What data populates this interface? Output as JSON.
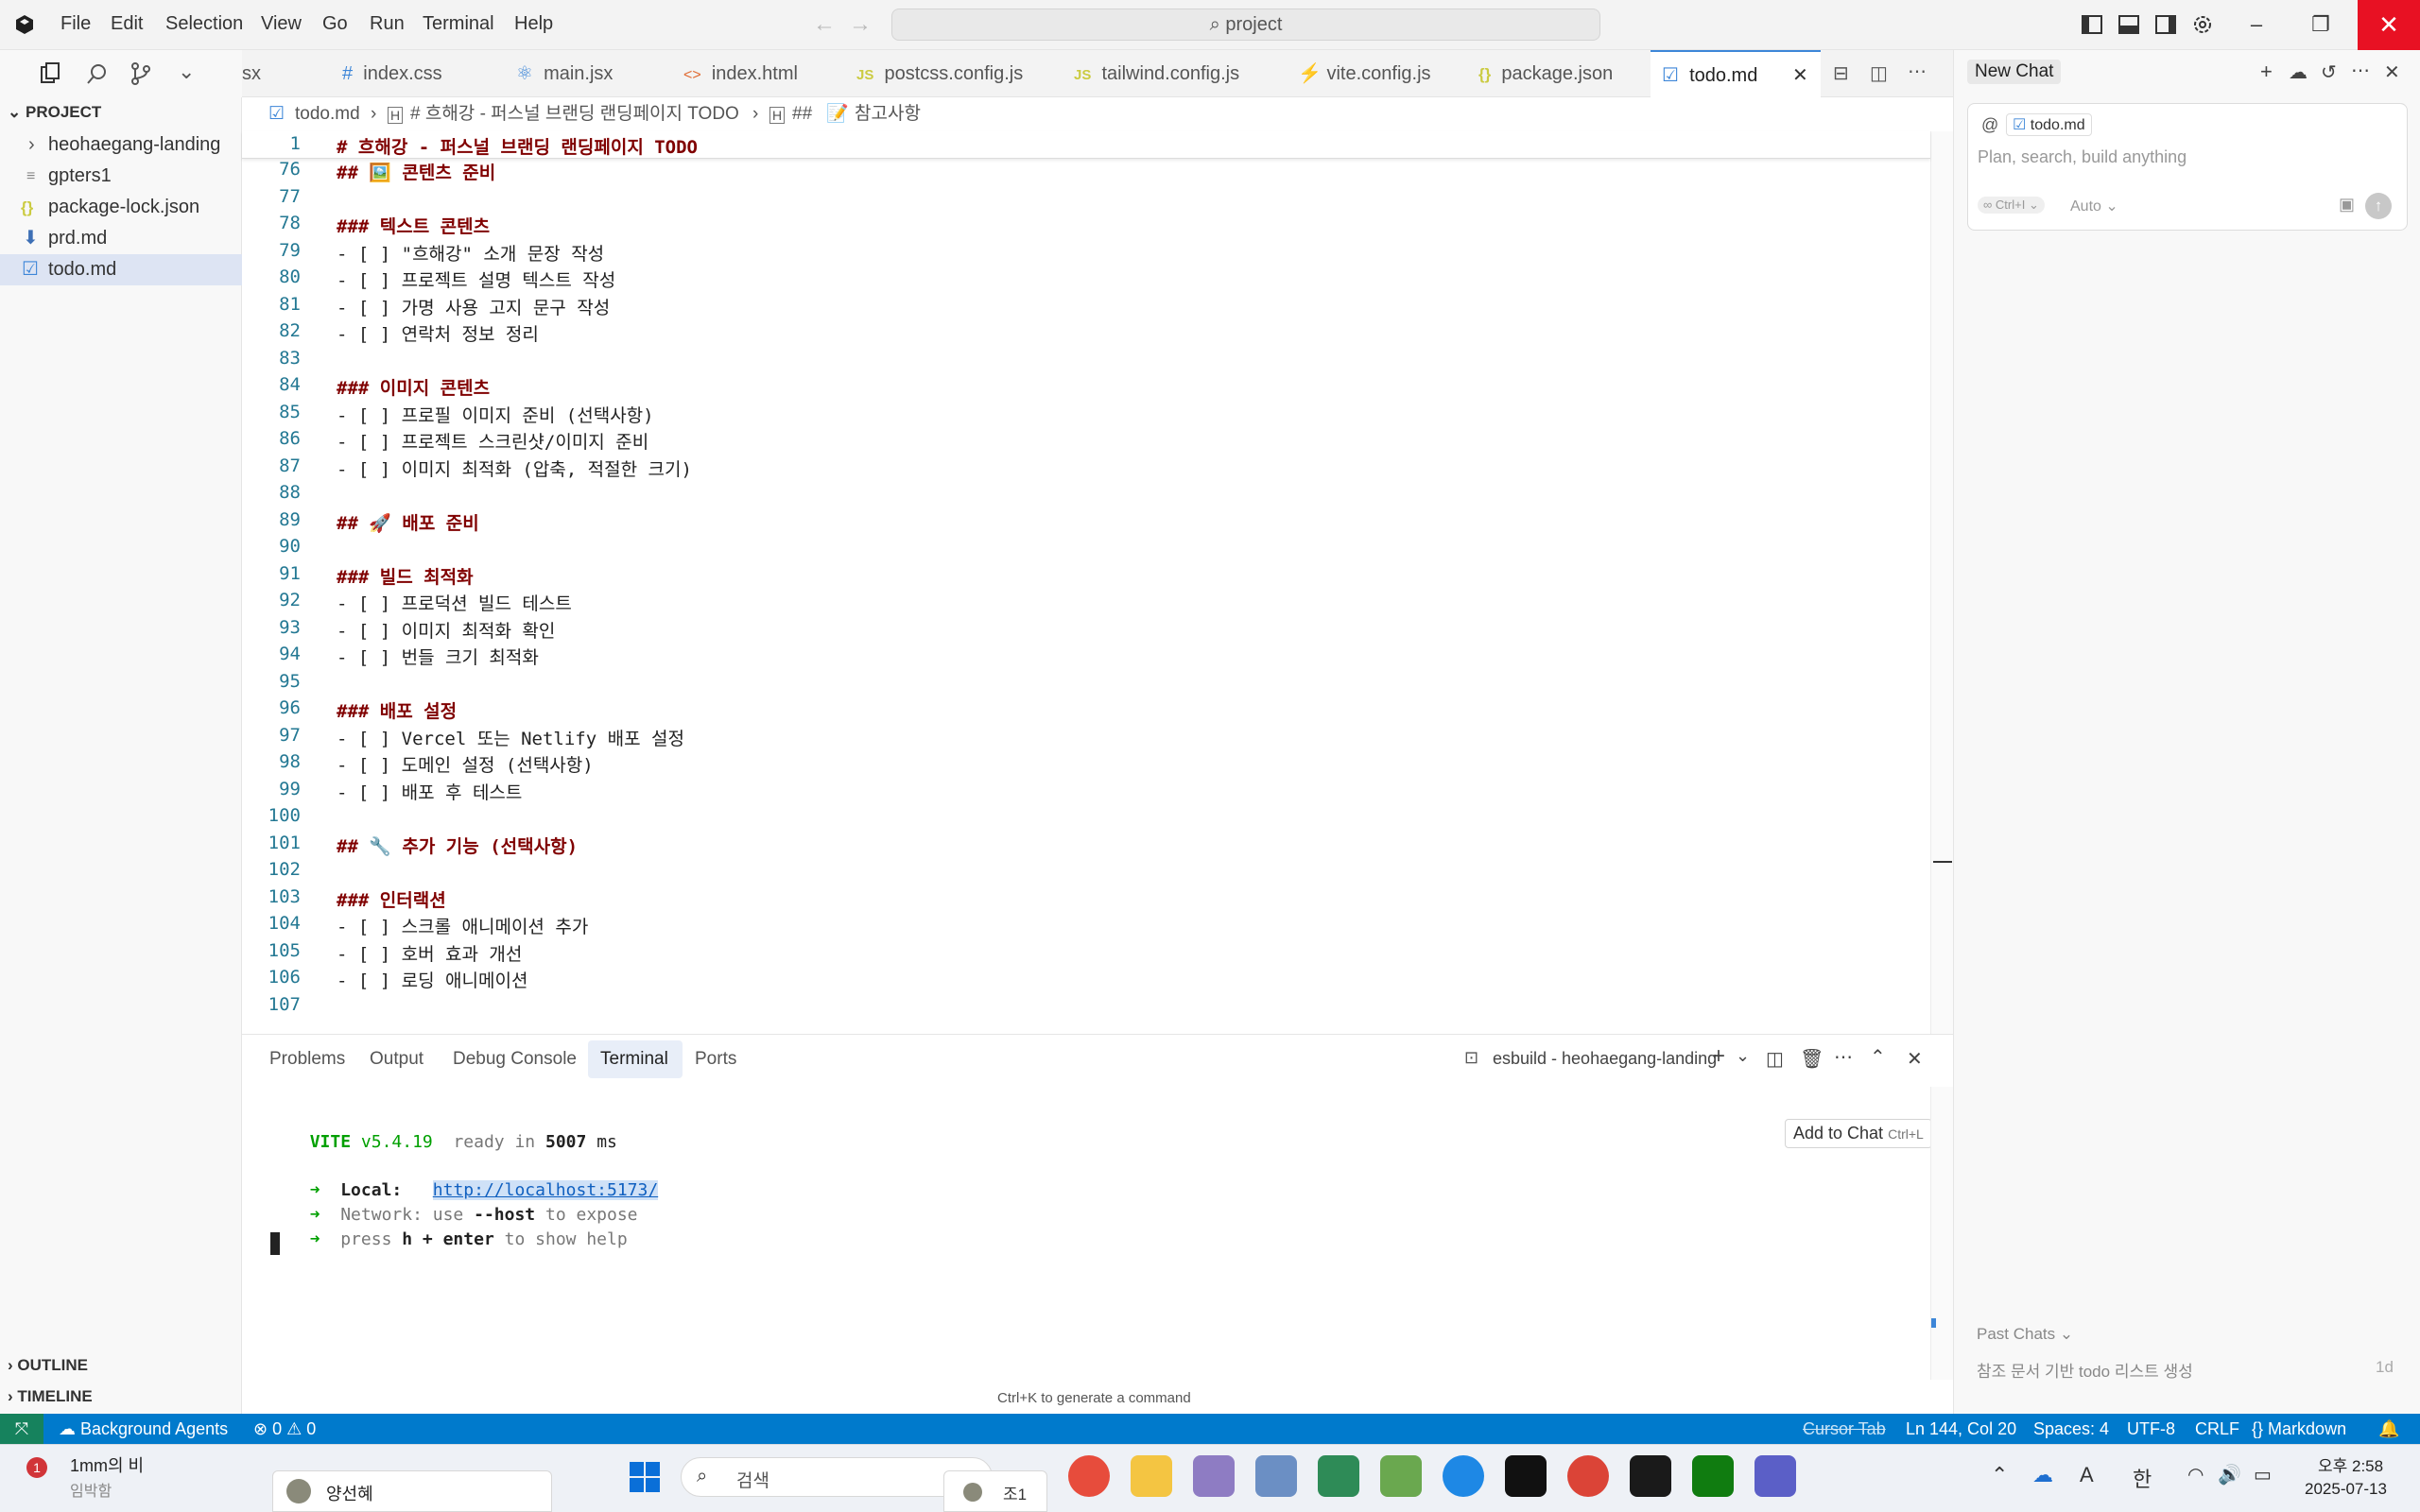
{
  "titlebar": {
    "menu": [
      "File",
      "Edit",
      "Selection",
      "View",
      "Go",
      "Run",
      "Terminal",
      "Help"
    ],
    "search_text": "project"
  },
  "sidebar": {
    "section_title": "PROJECT",
    "items": [
      {
        "label": "heohaegang-landing",
        "icon": "chevron-right-icon"
      },
      {
        "label": "gpters1",
        "icon": "text-file-icon"
      },
      {
        "label": "package-lock.json",
        "icon": "json-icon"
      },
      {
        "label": "prd.md",
        "icon": "markdown-download-icon"
      },
      {
        "label": "todo.md",
        "icon": "todo-file-icon"
      }
    ],
    "outline": "OUTLINE",
    "timeline": "TIMELINE"
  },
  "tabs": [
    {
      "label": "sx",
      "icon": ""
    },
    {
      "label": "index.css",
      "icon": "#"
    },
    {
      "label": "main.jsx",
      "icon": "⚛"
    },
    {
      "label": "index.html",
      "icon": "<>"
    },
    {
      "label": "postcss.config.js",
      "icon": "JS"
    },
    {
      "label": "tailwind.config.js",
      "icon": "JS"
    },
    {
      "label": "vite.config.js",
      "icon": "⚡"
    },
    {
      "label": "package.json",
      "icon": "{}"
    },
    {
      "label": "todo.md",
      "icon": "☑"
    }
  ],
  "breadcrumb": {
    "file": "todo.md",
    "h1": "# 흐해강 - 퍼스널 브랜딩 랜딩페이지 TODO",
    "h2": "##",
    "h3": "참고사항"
  },
  "editor": {
    "sticky_line_number": "1",
    "sticky_line_text": "# 흐해강 - 퍼스널 브랜딩 랜딩페이지 TODO",
    "lines": [
      {
        "n": "76",
        "t": "## 🖼️ 콘텐츠 준비",
        "h": true
      },
      {
        "n": "77",
        "t": "",
        "h": false
      },
      {
        "n": "78",
        "t": "### 텍스트 콘텐츠",
        "h": true
      },
      {
        "n": "79",
        "t": "- [ ] \"흐해강\" 소개 문장 작성",
        "h": false
      },
      {
        "n": "80",
        "t": "- [ ] 프로젝트 설명 텍스트 작성",
        "h": false
      },
      {
        "n": "81",
        "t": "- [ ] 가명 사용 고지 문구 작성",
        "h": false
      },
      {
        "n": "82",
        "t": "- [ ] 연락처 정보 정리",
        "h": false
      },
      {
        "n": "83",
        "t": "",
        "h": false
      },
      {
        "n": "84",
        "t": "### 이미지 콘텐츠",
        "h": true
      },
      {
        "n": "85",
        "t": "- [ ] 프로필 이미지 준비 (선택사항)",
        "h": false
      },
      {
        "n": "86",
        "t": "- [ ] 프로젝트 스크린샷/이미지 준비",
        "h": false
      },
      {
        "n": "87",
        "t": "- [ ] 이미지 최적화 (압축, 적절한 크기)",
        "h": false
      },
      {
        "n": "88",
        "t": "",
        "h": false
      },
      {
        "n": "89",
        "t": "## 🚀 배포 준비",
        "h": true
      },
      {
        "n": "90",
        "t": "",
        "h": false
      },
      {
        "n": "91",
        "t": "### 빌드 최적화",
        "h": true
      },
      {
        "n": "92",
        "t": "- [ ] 프로덕션 빌드 테스트",
        "h": false
      },
      {
        "n": "93",
        "t": "- [ ] 이미지 최적화 확인",
        "h": false
      },
      {
        "n": "94",
        "t": "- [ ] 번들 크기 최적화",
        "h": false
      },
      {
        "n": "95",
        "t": "",
        "h": false
      },
      {
        "n": "96",
        "t": "### 배포 설정",
        "h": true
      },
      {
        "n": "97",
        "t": "- [ ] Vercel 또는 Netlify 배포 설정",
        "h": false
      },
      {
        "n": "98",
        "t": "- [ ] 도메인 설정 (선택사항)",
        "h": false
      },
      {
        "n": "99",
        "t": "- [ ] 배포 후 테스트",
        "h": false
      },
      {
        "n": "100",
        "t": "",
        "h": false
      },
      {
        "n": "101",
        "t": "## 🔧 추가 기능 (선택사항)",
        "h": true
      },
      {
        "n": "102",
        "t": "",
        "h": false
      },
      {
        "n": "103",
        "t": "### 인터랙션",
        "h": true
      },
      {
        "n": "104",
        "t": "- [ ] 스크롤 애니메이션 추가",
        "h": false
      },
      {
        "n": "105",
        "t": "- [ ] 호버 효과 개선",
        "h": false
      },
      {
        "n": "106",
        "t": "- [ ] 로딩 애니메이션",
        "h": false
      },
      {
        "n": "107",
        "t": "",
        "h": false
      }
    ]
  },
  "panel": {
    "tabs": [
      "Problems",
      "Output",
      "Debug Console",
      "Terminal",
      "Ports"
    ],
    "terminal_name": "esbuild - heohaegang-landing",
    "add_to_chat": "Add to Chat",
    "add_to_chat_shortcut": "Ctrl+L",
    "vite_name": "VITE",
    "vite_version": "v5.4.19",
    "ready_text": "ready in",
    "ready_ms": "5007",
    "ms": "ms",
    "local_label": "Local:",
    "local_url": "http://localhost:5173/",
    "network_prefix": "Network: use",
    "network_flag": "--host",
    "network_suffix": "to expose",
    "press_prefix": "press",
    "press_key": "h + enter",
    "press_suffix": "to show help",
    "hint": "Ctrl+K to generate a command"
  },
  "chat": {
    "title": "New Chat",
    "context_file": "todo.md",
    "placeholder": "Plan, search, build anything",
    "mode_shortcut": "Ctrl+I",
    "model": "Auto",
    "past_chats": "Past Chats",
    "past_item": "참조 문서 기반 todo 리스트 생성",
    "past_item_age": "1d"
  },
  "statusbar": {
    "agents": "Background Agents",
    "errors": "0",
    "warnings": "0",
    "cursor_tab": "Cursor Tab",
    "position": "Ln 144, Col 20",
    "spaces": "Spaces: 4",
    "encoding": "UTF-8",
    "eol": "CRLF",
    "language": "Markdown"
  },
  "taskbar": {
    "weather_title": "1mm의 비",
    "weather_sub": "임박함",
    "weather_badge": "1",
    "window_label": "양선혜",
    "search_placeholder": "검색",
    "small_window": "조1",
    "ime": "한",
    "time": "오후 2:58",
    "date": "2025-07-13"
  },
  "colors": {
    "accent": "#007acc",
    "heading": "#800000",
    "line_number": "#237893",
    "close_red": "#e81123"
  }
}
